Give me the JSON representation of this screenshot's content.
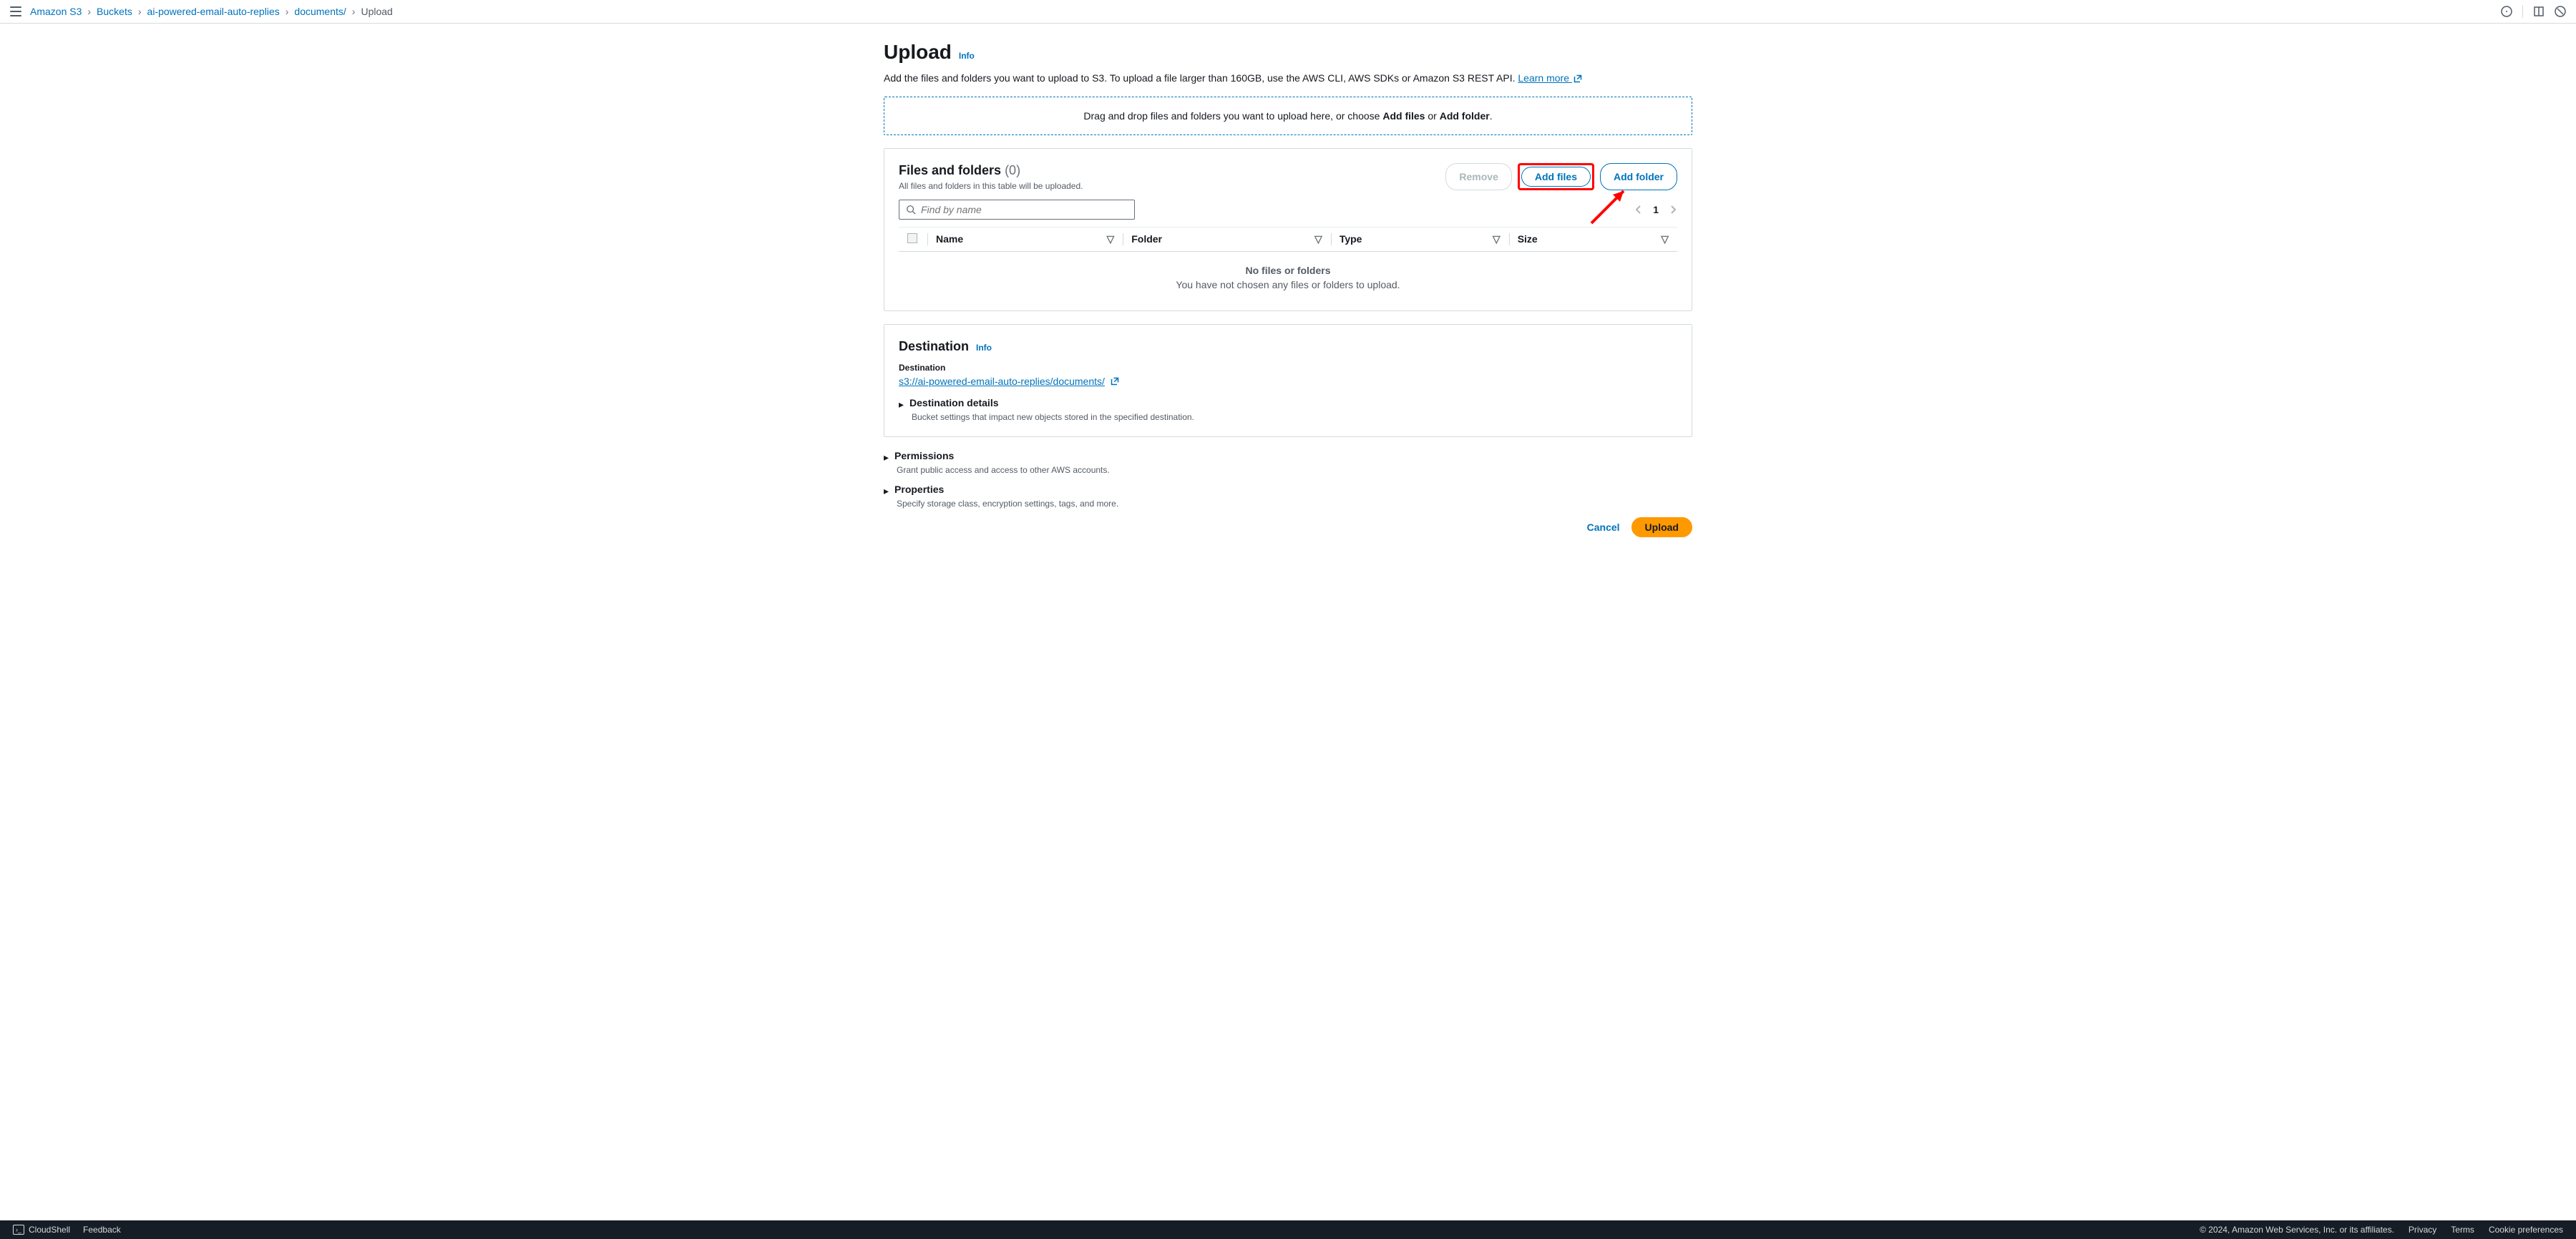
{
  "breadcrumb": {
    "items": [
      "Amazon S3",
      "Buckets",
      "ai-powered-email-auto-replies",
      "documents/"
    ],
    "current": "Upload"
  },
  "page": {
    "title": "Upload",
    "info": "Info",
    "description": "Add the files and folders you want to upload to S3. To upload a file larger than 160GB, use the AWS CLI, AWS SDKs or Amazon S3 REST API. ",
    "learn_more": "Learn more"
  },
  "dropzone": {
    "prefix": "Drag and drop files and folders you want to upload here, or choose ",
    "add_files": "Add files",
    "or": " or ",
    "add_folder": "Add folder",
    "suffix": "."
  },
  "files_card": {
    "title": "Files and folders",
    "count": "(0)",
    "subtitle": "All files and folders in this table will be uploaded.",
    "remove": "Remove",
    "add_files": "Add files",
    "add_folder": "Add folder",
    "search_placeholder": "Find by name",
    "page": "1",
    "columns": {
      "name": "Name",
      "folder": "Folder",
      "type": "Type",
      "size": "Size"
    },
    "empty_title": "No files or folders",
    "empty_sub": "You have not chosen any files or folders to upload."
  },
  "destination_card": {
    "title": "Destination",
    "info": "Info",
    "label": "Destination",
    "uri": "s3://ai-powered-email-auto-replies/documents/",
    "details_title": "Destination details",
    "details_sub": "Bucket settings that impact new objects stored in the specified destination."
  },
  "permissions": {
    "title": "Permissions",
    "sub": "Grant public access and access to other AWS accounts."
  },
  "properties": {
    "title": "Properties",
    "sub": "Specify storage class, encryption settings, tags, and more."
  },
  "actions": {
    "cancel": "Cancel",
    "upload": "Upload"
  },
  "footer": {
    "cloudshell": "CloudShell",
    "feedback": "Feedback",
    "copyright": "© 2024, Amazon Web Services, Inc. or its affiliates.",
    "privacy": "Privacy",
    "terms": "Terms",
    "cookie": "Cookie preferences"
  }
}
